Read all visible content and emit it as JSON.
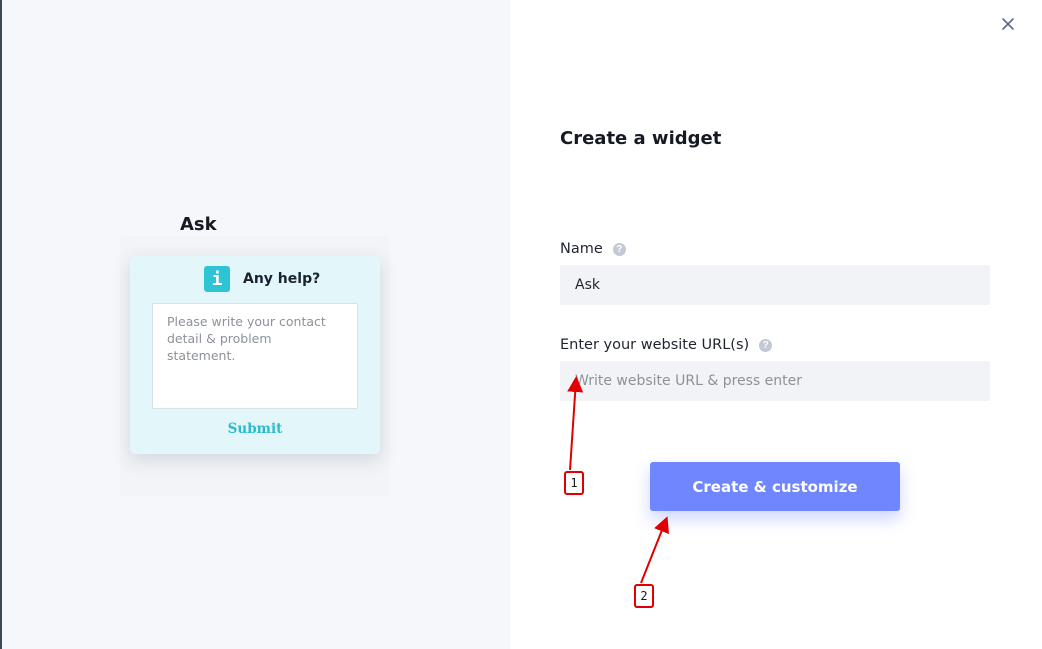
{
  "preview": {
    "title": "Ask",
    "card_title": "Any help?",
    "info_icon_glyph": "i",
    "textarea_placeholder": "Please write your contact detail & problem statement.",
    "submit_label": "Submit",
    "accent_color": "#2ec4d6"
  },
  "dialog": {
    "close_icon": "close-icon",
    "heading": "Create a widget",
    "name_label": "Name",
    "name_value": "Ask",
    "url_label": "Enter your website URL(s)",
    "url_placeholder": "Write website URL & press enter",
    "help_glyph": "?",
    "create_button_label": "Create & customize",
    "button_color": "#6f86ff"
  },
  "annotations": {
    "step1_label": "1",
    "step2_label": "2",
    "arrow_color": "#e00000"
  }
}
